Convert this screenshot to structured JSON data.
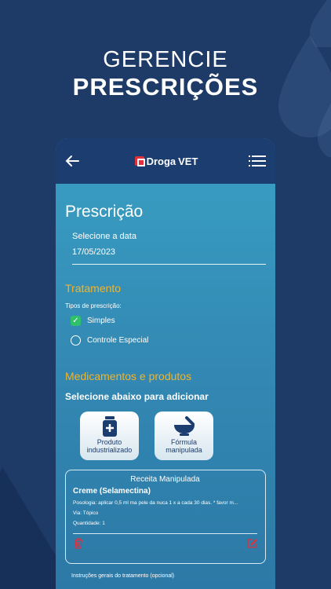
{
  "headline": {
    "line1": "GERENCIE",
    "line2": "PRESCRIÇÕES"
  },
  "topbar": {
    "logo_prefix": "Droga",
    "logo_suffix": "VET"
  },
  "page": {
    "title": "Prescrição"
  },
  "date": {
    "label": "Selecione a data",
    "value": "17/05/2023"
  },
  "tratamento": {
    "title": "Tratamento",
    "tipos_label": "Tipos de prescrição:",
    "options": [
      {
        "label": "Simples",
        "checked": true
      },
      {
        "label": "Controle Especial",
        "checked": false
      }
    ]
  },
  "medicamentos": {
    "title": "Medicamentos e produtos",
    "subtitle": "Selecione abaixo para adicionar",
    "cards": [
      {
        "line1": "Produto",
        "line2": "industrializado",
        "icon": "medicine-bottle-icon"
      },
      {
        "line1": "Fórmula",
        "line2": "manipulada",
        "icon": "mortar-pestle-icon"
      }
    ]
  },
  "recipe": {
    "header": "Receita Manipulada",
    "name": "Creme (Selamectina)",
    "posologia": "Posologia: aplicar 0,5 ml ma pele da nuca 1 x a cada 30 dias. * favor m...",
    "via": "Via: Tópico",
    "quantidade": "Quantidade: 1"
  },
  "instructions": {
    "label": "Instruções gerais do tratamento (opcional)"
  },
  "colors": {
    "accent": "#f2b32a",
    "topbar": "#1b3d70",
    "danger": "#e0303a",
    "check": "#2ec06a"
  }
}
